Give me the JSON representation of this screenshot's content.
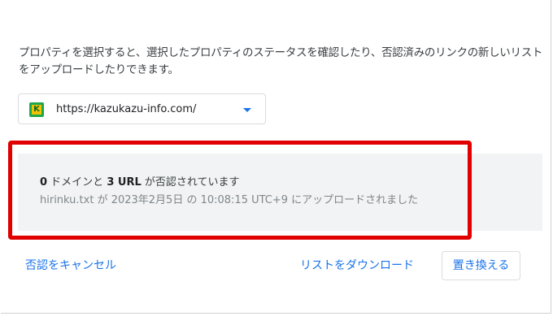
{
  "description": "プロパティを選択すると、選択したプロパティのステータスを確認したり、否認済みのリンクの新しいリストをアップロードしたりできます。",
  "property": {
    "logo_letter": "K",
    "url": "https://kazukazu-info.com/"
  },
  "status": {
    "domains_count": "0",
    "domains_text": " ドメインと ",
    "urls_count": "3 URL",
    "urls_text": " が否認されています",
    "file_name": "hirinku.txt",
    "upload_text": " が 2023年2月5日 の 10:08:15 UTC+9 にアップロードされました"
  },
  "actions": {
    "cancel_label": "否認をキャンセル",
    "download_label": "リストをダウンロード",
    "replace_label": "置き換える"
  },
  "colors": {
    "accent": "#1a73e8",
    "highlight": "#e00000",
    "panel_bg": "#f1f3f4"
  }
}
